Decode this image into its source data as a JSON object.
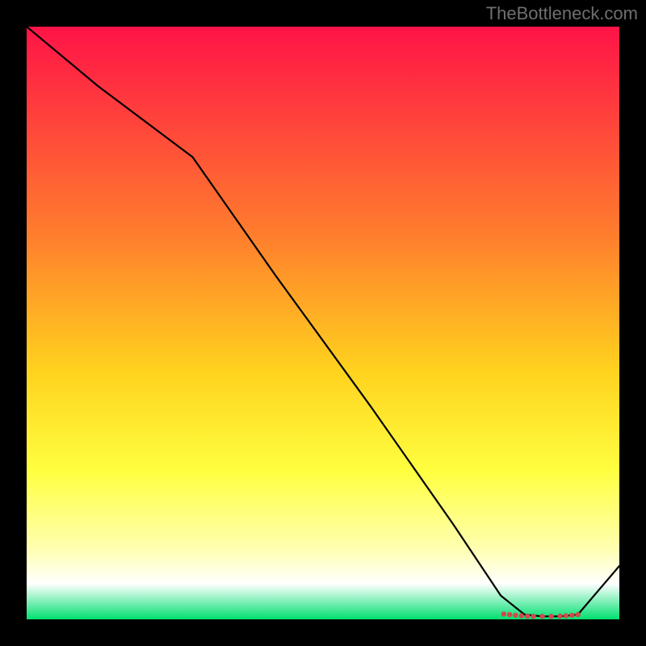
{
  "watermark": "TheBottleneck.com",
  "chart_data": {
    "type": "line",
    "title": "",
    "xlabel": "",
    "ylabel": "",
    "xlim": [
      0,
      100
    ],
    "ylim": [
      0,
      100
    ],
    "gradient_stops": [
      {
        "offset": 0,
        "color": "#ff1347"
      },
      {
        "offset": 35,
        "color": "#ff7d2d"
      },
      {
        "offset": 58,
        "color": "#ffd21e"
      },
      {
        "offset": 75,
        "color": "#ffff40"
      },
      {
        "offset": 88,
        "color": "#ffffb0"
      },
      {
        "offset": 94,
        "color": "#ffffff"
      },
      {
        "offset": 100,
        "color": "#00e070"
      }
    ],
    "series": [
      {
        "name": "bottleneck-curve",
        "x": [
          0,
          12,
          28,
          42,
          58,
          72,
          80,
          84,
          87,
          90,
          93,
          100
        ],
        "y": [
          100,
          90,
          78,
          58,
          36,
          16,
          4,
          0.8,
          0.5,
          0.5,
          0.8,
          9
        ]
      }
    ],
    "markers": {
      "name": "optimal-range-markers",
      "x": [
        80.5,
        81.5,
        82.5,
        83.5,
        84.5,
        85.5,
        87.0,
        88.5,
        90.0,
        91.0,
        92.0,
        93.0
      ],
      "y": [
        0.9,
        0.8,
        0.7,
        0.6,
        0.55,
        0.5,
        0.5,
        0.5,
        0.55,
        0.6,
        0.7,
        0.8
      ]
    }
  }
}
